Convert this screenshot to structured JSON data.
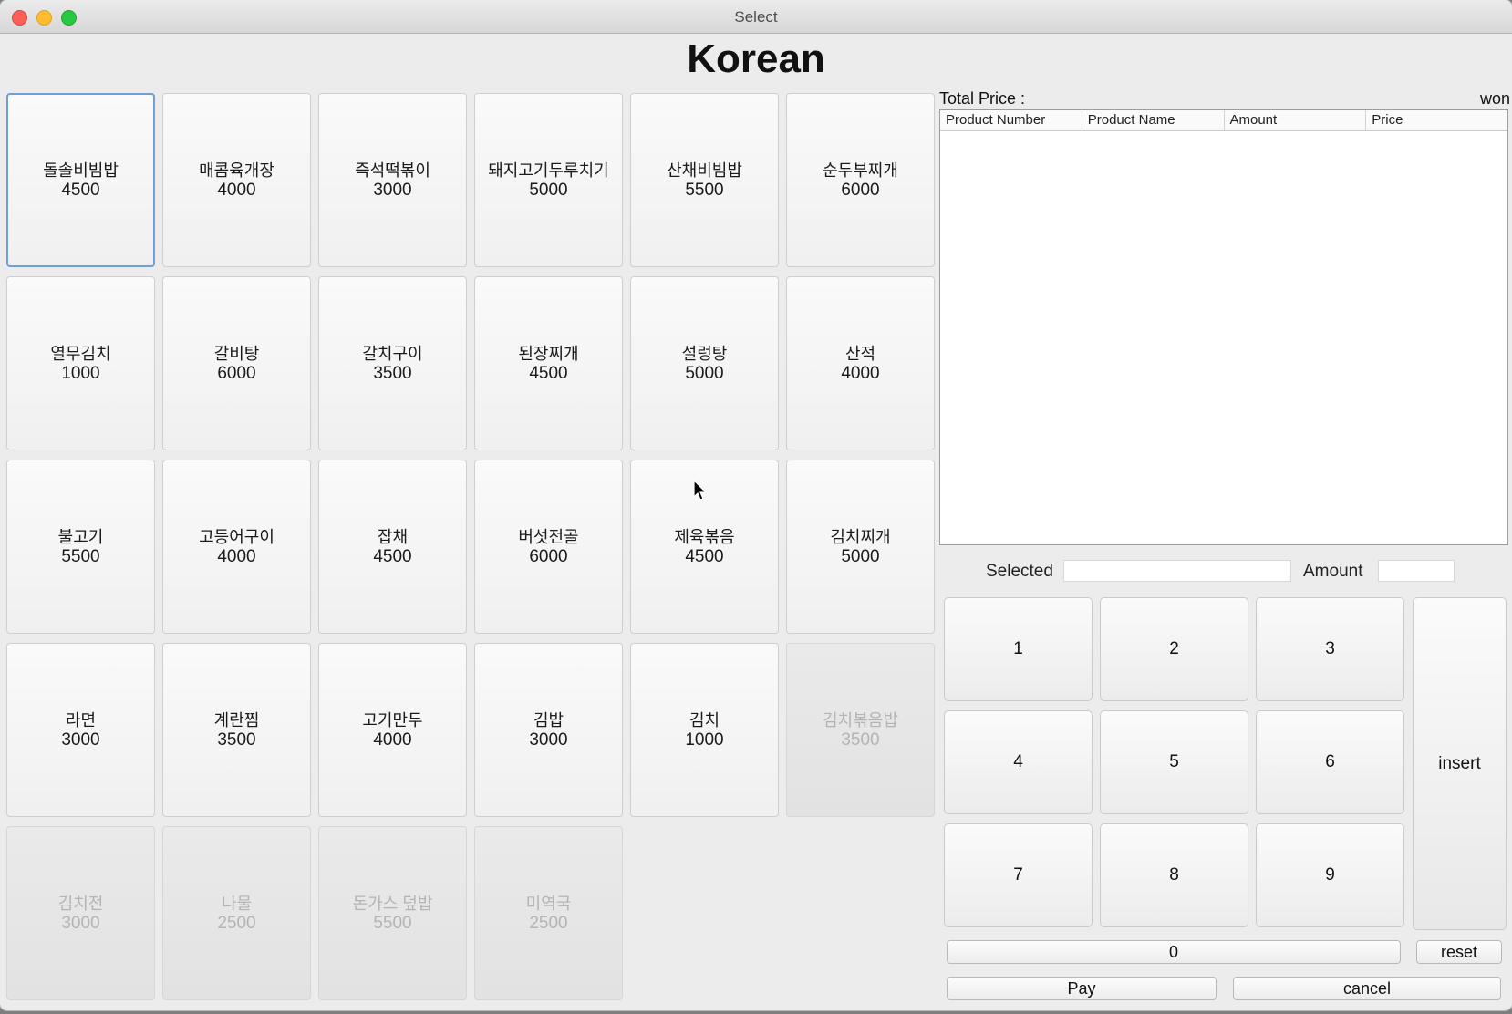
{
  "window": {
    "title": "Select"
  },
  "heading": "Korean",
  "menu": [
    {
      "name": "돌솔비빔밥",
      "price": "4500",
      "state": "focused"
    },
    {
      "name": "매콤육개장",
      "price": "4000",
      "state": "enabled"
    },
    {
      "name": "즉석떡볶이",
      "price": "3000",
      "state": "enabled"
    },
    {
      "name": "돼지고기두루치기",
      "price": "5000",
      "state": "enabled"
    },
    {
      "name": "산채비빔밥",
      "price": "5500",
      "state": "enabled"
    },
    {
      "name": "순두부찌개",
      "price": "6000",
      "state": "enabled"
    },
    {
      "name": "열무김치",
      "price": "1000",
      "state": "enabled"
    },
    {
      "name": "갈비탕",
      "price": "6000",
      "state": "enabled"
    },
    {
      "name": "갈치구이",
      "price": "3500",
      "state": "enabled"
    },
    {
      "name": "된장찌개",
      "price": "4500",
      "state": "enabled"
    },
    {
      "name": "설렁탕",
      "price": "5000",
      "state": "enabled"
    },
    {
      "name": "산적",
      "price": "4000",
      "state": "enabled"
    },
    {
      "name": "불고기",
      "price": "5500",
      "state": "enabled"
    },
    {
      "name": "고등어구이",
      "price": "4000",
      "state": "enabled"
    },
    {
      "name": "잡채",
      "price": "4500",
      "state": "enabled"
    },
    {
      "name": "버섯전골",
      "price": "6000",
      "state": "enabled"
    },
    {
      "name": "제육볶음",
      "price": "4500",
      "state": "enabled"
    },
    {
      "name": "김치찌개",
      "price": "5000",
      "state": "enabled"
    },
    {
      "name": "라면",
      "price": "3000",
      "state": "enabled"
    },
    {
      "name": "계란찜",
      "price": "3500",
      "state": "enabled"
    },
    {
      "name": "고기만두",
      "price": "4000",
      "state": "enabled"
    },
    {
      "name": "김밥",
      "price": "3000",
      "state": "enabled"
    },
    {
      "name": "김치",
      "price": "1000",
      "state": "enabled"
    },
    {
      "name": "김치볶음밥",
      "price": "3500",
      "state": "disabled"
    },
    {
      "name": "김치전",
      "price": "3000",
      "state": "disabled"
    },
    {
      "name": "나물",
      "price": "2500",
      "state": "disabled"
    },
    {
      "name": "돈가스 덮밥",
      "price": "5500",
      "state": "disabled"
    },
    {
      "name": "미역국",
      "price": "2500",
      "state": "disabled"
    }
  ],
  "order": {
    "total_label": "Total Price :",
    "currency": "won",
    "columns": [
      "Product Number",
      "Product Name",
      "Amount",
      "Price"
    ],
    "rows": []
  },
  "selection": {
    "selected_label": "Selected",
    "selected_value": "",
    "amount_label": "Amount",
    "amount_value": ""
  },
  "keypad": {
    "digits": [
      "1",
      "2",
      "3",
      "4",
      "5",
      "6",
      "7",
      "8",
      "9"
    ],
    "zero": "0",
    "insert": "insert",
    "reset": "reset",
    "pay": "Pay",
    "cancel": "cancel"
  },
  "colors": {
    "focus_border": "#6e9fd6",
    "disabled_text": "#b4b4b4"
  },
  "icons": {
    "cursor": "mouse-pointer-icon"
  }
}
